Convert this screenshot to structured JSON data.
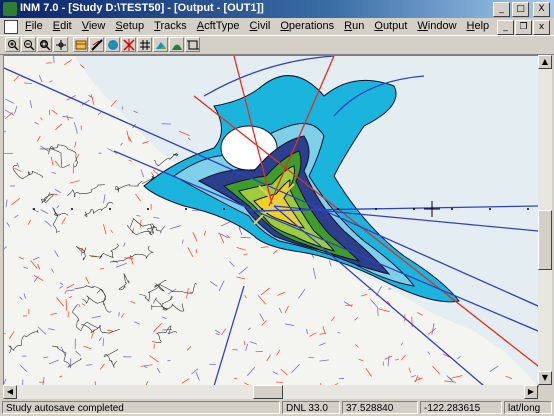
{
  "window": {
    "title": "INM 7.0 - [Study D:\\TEST50] - [Output - [OUT1]]",
    "controls": {
      "minimize": "_",
      "maximize": "□",
      "close": "X"
    }
  },
  "menu": {
    "items": [
      "File",
      "Edit",
      "View",
      "Setup",
      "Tracks",
      "AcftType",
      "Civil",
      "Operations",
      "Run",
      "Output",
      "Window",
      "Help"
    ],
    "mdi_controls": {
      "minimize": "_",
      "restore": "❐",
      "close": "x"
    }
  },
  "toolbar": {
    "tools": [
      "zoom-in",
      "zoom-out",
      "zoom-window",
      "pan",
      "layers",
      "runway",
      "tracks",
      "flight-points",
      "grid",
      "population",
      "contour",
      "noise-terrain",
      "select-box"
    ]
  },
  "map": {
    "colors": {
      "background": "#e4edf1",
      "land": "#f4f4f0",
      "contour_outer": "#1ab4dc",
      "contour_2": "#7ed0e8",
      "contour_3": "#2c3f8c",
      "contour_4": "#3d9c2a",
      "contour_5": "#9fcd3a",
      "contour_6": "#f0d020",
      "track_red": "#e03020",
      "track_blue": "#3040c0",
      "roads": "#7b6fc8",
      "census": "#ff4a35"
    }
  },
  "status": {
    "message": "Study autosave completed",
    "metric": "DNL 33.0",
    "latitude": "37.528840",
    "longitude": "-122.283615",
    "coord_mode": "lat/long"
  }
}
